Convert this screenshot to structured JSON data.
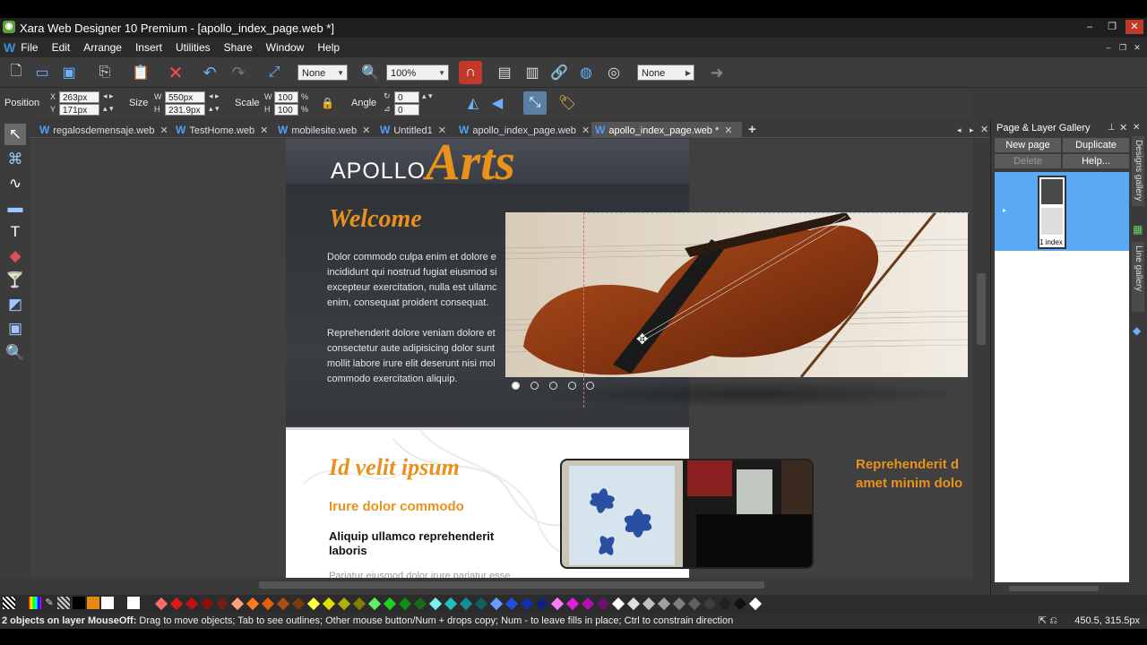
{
  "window": {
    "title": "Xara Web Designer 10 Premium - [apollo_index_page.web *]",
    "app_icon": "xara-icon",
    "buttons": {
      "minimize": "–",
      "restore": "❐",
      "close": "✕"
    }
  },
  "menubar": {
    "items": [
      "File",
      "Edit",
      "Arrange",
      "Insert",
      "Utilities",
      "Share",
      "Window",
      "Help"
    ]
  },
  "toolbar": {
    "feather_value": "None",
    "zoom_value": "100%",
    "transparency_value": "None"
  },
  "infobar": {
    "position_label": "Position",
    "x_label": "X",
    "x_value": "263px",
    "y_label": "Y",
    "y_value": "171px",
    "size_label": "Size",
    "w_label": "W",
    "w_value": "550px",
    "h_label": "H",
    "h_value": "231.9px",
    "scale_label": "Scale",
    "scale_w_label": "W",
    "scale_w_value": "100",
    "scale_h_label": "H",
    "scale_h_value": "100",
    "percent": "%",
    "angle_label": "Angle",
    "angle_value": "0",
    "skew_value": "0"
  },
  "tabs": [
    {
      "label": "regalosdemensaje.web",
      "active": false
    },
    {
      "label": "TestHome.web",
      "active": false
    },
    {
      "label": "mobilesite.web",
      "active": false
    },
    {
      "label": "Untitled1",
      "active": false
    },
    {
      "label": "apollo_index_page.web",
      "active": false
    },
    {
      "label": "apollo_index_page.web *",
      "active": true
    }
  ],
  "page": {
    "logo_apollo": "APOLLO",
    "logo_arts": "Arts",
    "welcome": "Welcome",
    "para1": [
      "Dolor commodo culpa enim et dolore e",
      "incididunt qui nostrud fugiat eiusmod si",
      "excepteur exercitation, nulla est ullamc",
      "enim, consequat proident consequat."
    ],
    "para2": [
      "Reprehenderit dolore veniam dolore et",
      "consectetur aute adipisicing dolor sunt",
      "mollit labore irure elit deserunt nisi mol",
      "commodo exercitation aliquip."
    ],
    "heading_ipsum": "Id velit ipsum",
    "heading_irure": "Irure dolor commodo",
    "heading_aliquip": "Aliquip ullamco reprehenderit laboris",
    "para_pariatur": "Pariatur eiusmod dolor irure pariatur esse",
    "side_text_1": "Reprehenderit d",
    "side_text_2": "amet minim dolo",
    "slider_active_index": 0,
    "slider_count": 5
  },
  "gallery": {
    "title": "Page & Layer Gallery",
    "new_page": "New page",
    "duplicate": "Duplicate",
    "delete": "Delete",
    "help": "Help...",
    "thumb_label": "1 index"
  },
  "side_tabs": {
    "designs": "Designs gallery",
    "line": "Line gallery"
  },
  "status": {
    "bold": "2 objects on layer MouseOff:",
    "text": " Drag to move objects; Tab to see outlines; Other mouse button/Num + drops copy; Num - to leave fills in place; Ctrl to constrain direction",
    "coords": "450.5, 315.5px"
  },
  "palette": {
    "colors": [
      "#ff6b6b",
      "#e01818",
      "#c01010",
      "#901010",
      "#7a1c1c",
      "#ff9f7a",
      "#ff7a1a",
      "#e06010",
      "#b05010",
      "#7a3a10",
      "#ffff44",
      "#e0e000",
      "#b0b000",
      "#808000",
      "#60f060",
      "#20d020",
      "#109010",
      "#1a6a1a",
      "#7af0f0",
      "#20c0c0",
      "#109090",
      "#106060",
      "#6a9aff",
      "#2050e0",
      "#1030b0",
      "#102080",
      "#ff7aff",
      "#e020e0",
      "#b010b0",
      "#701070",
      "#ffffff",
      "#e0e0e0",
      "#c0c0c0",
      "#a0a0a0",
      "#808080",
      "#606060",
      "#404040",
      "#202020",
      "#101010",
      "#ffffff"
    ]
  }
}
